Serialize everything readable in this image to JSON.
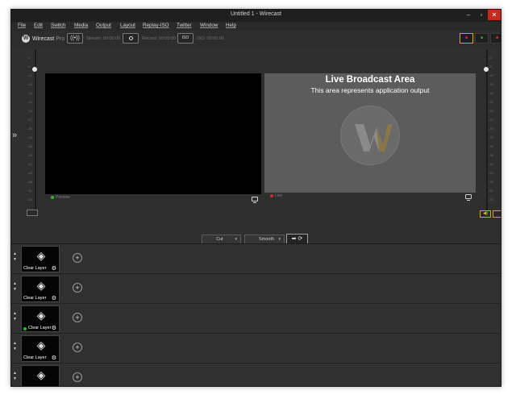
{
  "window": {
    "title": "Untitled 1 - Wirecast",
    "minimize": "–",
    "maximize": "▫",
    "close": "✕"
  },
  "menu": [
    "File",
    "Edit",
    "Switch",
    "Media",
    "Output",
    "Layout",
    "Replay-ISO",
    "Twitter",
    "Window",
    "Help"
  ],
  "toolbar": {
    "logo_glyph": "W",
    "brand": "Wirecast",
    "edition": "Pro",
    "stream_icon": "((•))",
    "stream": "Stream: 00:00:00",
    "record": "Record: 00:00:00",
    "iso_icon": "ISO",
    "iso": "ISO: 00:00:00",
    "monitor_glyph": "■"
  },
  "stage": {
    "expand_glyph": "»",
    "preview_label": "Preview",
    "live_label": "Live",
    "live_title": "Live Broadcast Area",
    "live_subtitle": "This area represents application output",
    "speaker_glyph": "◀)",
    "left_meter_ticks": [
      "-6",
      "-9",
      "-12",
      "-15",
      "-18",
      "-21",
      "-24",
      "-27",
      "-30",
      "-33",
      "-36",
      "-39",
      "-42",
      "-45",
      "-48",
      "-51",
      "-54"
    ],
    "right_meter_ticks": [
      "-6",
      "-9",
      "-12",
      "-15",
      "-18",
      "-21",
      "-24",
      "-27",
      "-30",
      "-33",
      "-36",
      "-39",
      "-42",
      "-45",
      "-48",
      "-51",
      "-54"
    ]
  },
  "transitions": {
    "cut": "Cut",
    "smooth": "Smooth",
    "dropdown_arrow": "▼",
    "go": "➡ ⟳"
  },
  "layers": [
    {
      "label": "Clear Layer",
      "live": false
    },
    {
      "label": "Clear Layer",
      "live": false
    },
    {
      "label": "Clear Layer",
      "live": true
    },
    {
      "label": "Clear Layer",
      "live": false
    },
    {
      "label": "",
      "live": false
    }
  ],
  "layer_controls": {
    "up": "▲",
    "down": "▼",
    "add": "+",
    "gear": "⚙",
    "stack": "◈"
  },
  "colors": {
    "accent": "#d9a31a",
    "live_red": "#d42a2a",
    "preview_green": "#2fb52f",
    "bg": "#2d2d2d"
  }
}
